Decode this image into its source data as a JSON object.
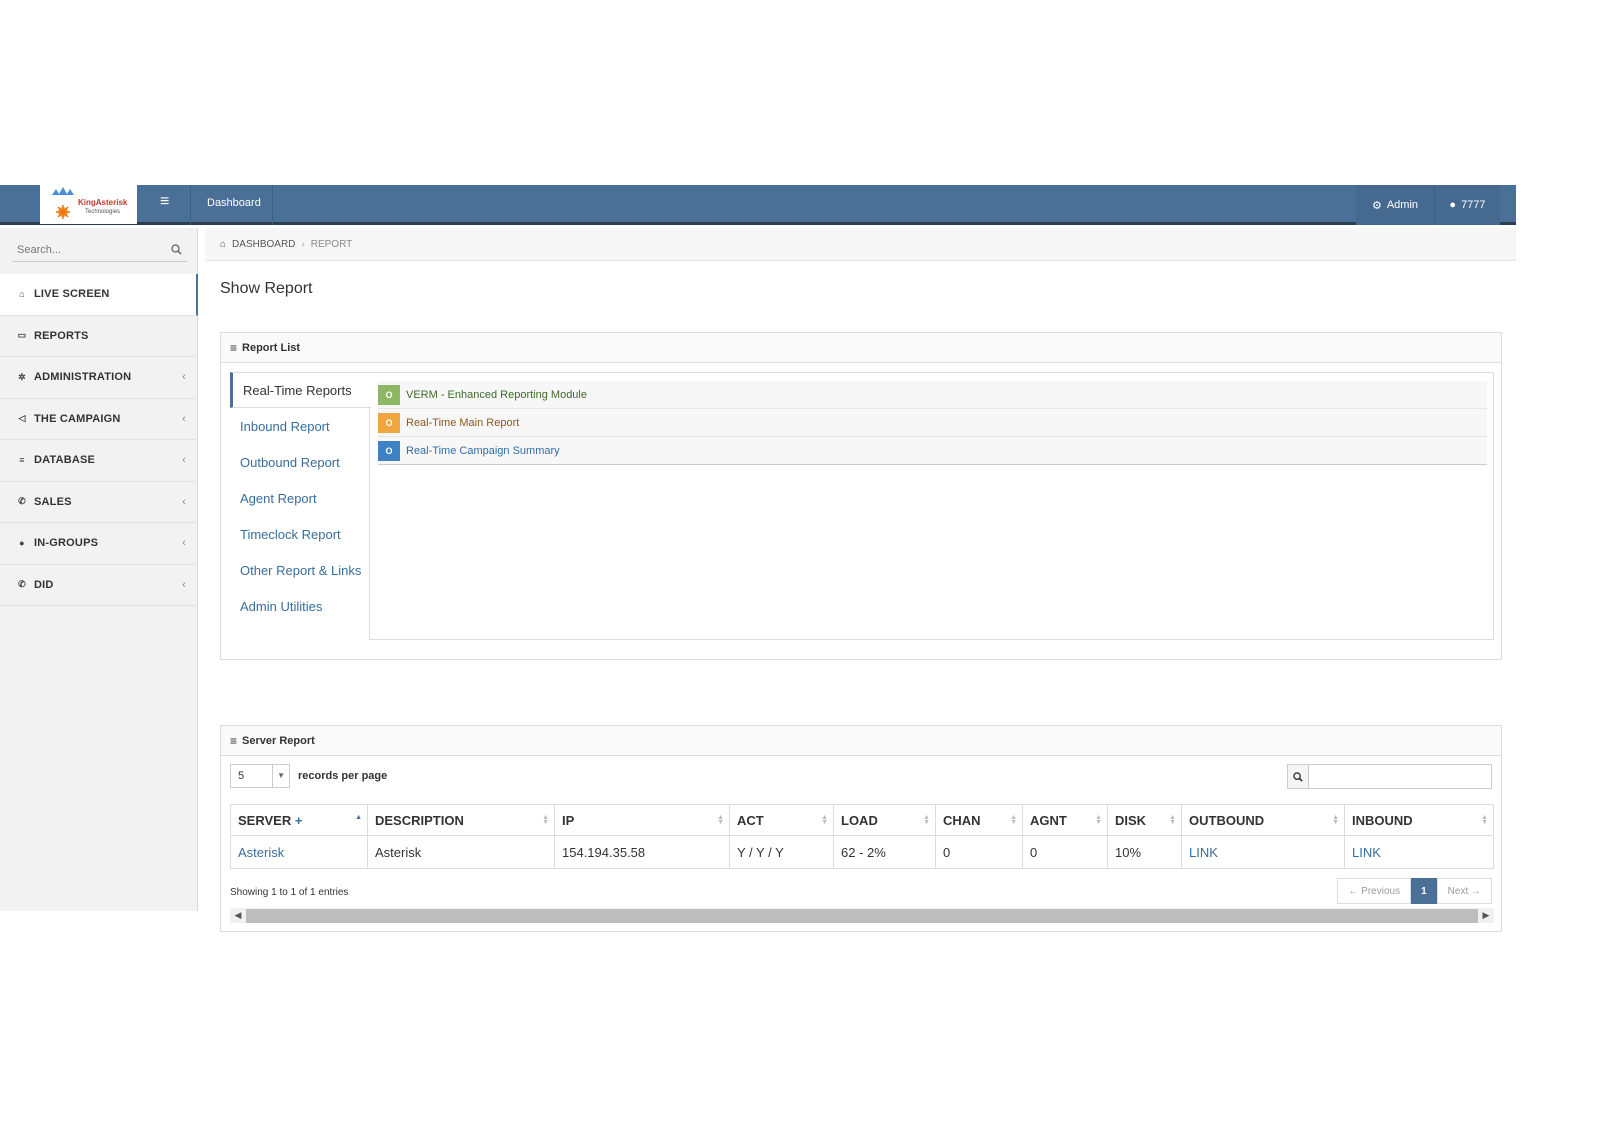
{
  "brand": {
    "logo_line1": "KingAsterisk",
    "logo_line2": "Technologies"
  },
  "topbar": {
    "dashboard_label": "Dashboard",
    "admin_label": "Admin",
    "user_label": "7777",
    "color": "#4a7098"
  },
  "sidebar": {
    "search_placeholder": "Search...",
    "items": [
      {
        "label": "LIVE SCREEN",
        "icon": "home-icon",
        "glyph": "⌂",
        "has_chevron": false
      },
      {
        "label": "REPORTS",
        "icon": "image-icon",
        "glyph": "▭",
        "has_chevron": false
      },
      {
        "label": "ADMINISTRATION",
        "icon": "gear-icon",
        "glyph": "✲",
        "has_chevron": true
      },
      {
        "label": "THE CAMPAIGN",
        "icon": "megaphone-icon",
        "glyph": "◁",
        "has_chevron": true
      },
      {
        "label": "DATABASE",
        "icon": "database-icon",
        "glyph": "≡",
        "has_chevron": true
      },
      {
        "label": "SALES",
        "icon": "phone-icon",
        "glyph": "✆",
        "has_chevron": true
      },
      {
        "label": "IN-GROUPS",
        "icon": "user-icon",
        "glyph": "●",
        "has_chevron": true
      },
      {
        "label": "DID",
        "icon": "phone-icon",
        "glyph": "✆",
        "has_chevron": true
      }
    ],
    "chevron": "‹"
  },
  "breadcrumb": {
    "home": "DASHBOARD",
    "current": "REPORT"
  },
  "page_title": "Show Report",
  "report_list": {
    "title": "Report List",
    "tabs": [
      "Real-Time Reports",
      "Inbound Report",
      "Outbound Report",
      "Agent Report",
      "Timeclock Report",
      "Other Report & Links",
      "Admin Utilities"
    ],
    "items": [
      {
        "label": "VERM - Enhanced Reporting Module",
        "badge_color": "#8db764",
        "text_color": "#3d6b2a"
      },
      {
        "label": "Real-Time Main Report",
        "badge_color": "#f0a640",
        "text_color": "#8a5a1a"
      },
      {
        "label": "Real-Time Campaign Summary",
        "badge_color": "#3f82c3",
        "text_color": "#2f6ea8"
      }
    ]
  },
  "server_report": {
    "title": "Server Report",
    "per_page_value": "5",
    "per_page_label": "records per page",
    "columns": [
      "SERVER",
      "DESCRIPTION",
      "IP",
      "ACT",
      "LOAD",
      "CHAN",
      "AGNT",
      "DISK",
      "OUTBOUND",
      "INBOUND"
    ],
    "server_plus": "+",
    "rows": [
      [
        "Asterisk",
        "Asterisk",
        "154.194.35.58",
        "Y / Y / Y",
        "62 - 2%",
        "0",
        "0",
        "10%",
        "LINK",
        "LINK"
      ]
    ],
    "info": "Showing 1 to 1 of 1 entries",
    "prev_label": "← Previous",
    "page": "1",
    "next_label": "Next →"
  }
}
